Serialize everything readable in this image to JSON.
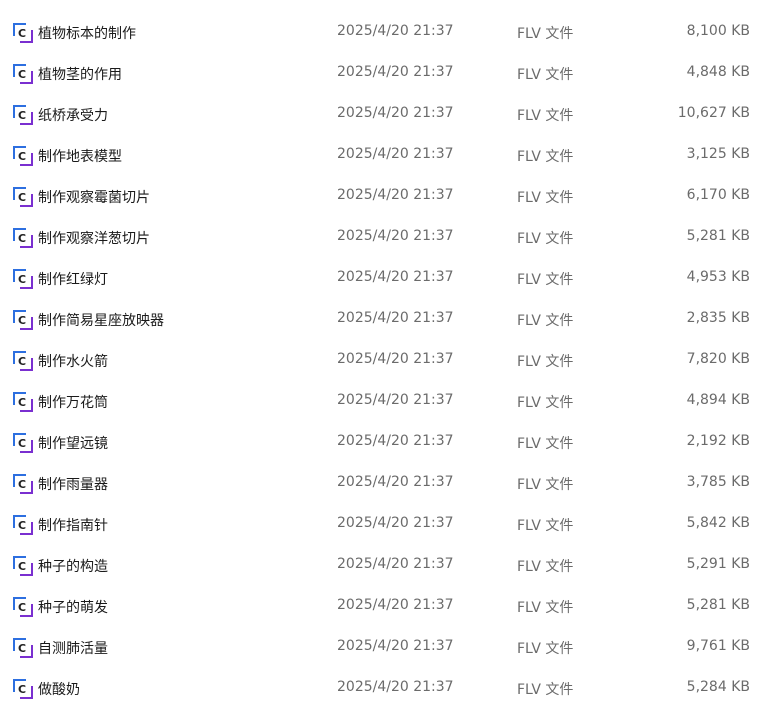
{
  "icon": "video-file-icon",
  "colors": {
    "icon_blue": "#2d6fe0",
    "icon_purple": "#7a2fd0",
    "text": "#1a1a1a",
    "meta": "#6b6b6b"
  },
  "files": [
    {
      "name": "植物标本的制作",
      "date": "2025/4/20 21:37",
      "type": "FLV 文件",
      "size": "8,100 KB"
    },
    {
      "name": "植物茎的作用",
      "date": "2025/4/20 21:37",
      "type": "FLV 文件",
      "size": "4,848 KB"
    },
    {
      "name": "纸桥承受力",
      "date": "2025/4/20 21:37",
      "type": "FLV 文件",
      "size": "10,627 KB"
    },
    {
      "name": "制作地表模型",
      "date": "2025/4/20 21:37",
      "type": "FLV 文件",
      "size": "3,125 KB"
    },
    {
      "name": "制作观察霉菌切片",
      "date": "2025/4/20 21:37",
      "type": "FLV 文件",
      "size": "6,170 KB"
    },
    {
      "name": "制作观察洋葱切片",
      "date": "2025/4/20 21:37",
      "type": "FLV 文件",
      "size": "5,281 KB"
    },
    {
      "name": "制作红绿灯",
      "date": "2025/4/20 21:37",
      "type": "FLV 文件",
      "size": "4,953 KB"
    },
    {
      "name": "制作简易星座放映器",
      "date": "2025/4/20 21:37",
      "type": "FLV 文件",
      "size": "2,835 KB"
    },
    {
      "name": "制作水火箭",
      "date": "2025/4/20 21:37",
      "type": "FLV 文件",
      "size": "7,820 KB"
    },
    {
      "name": "制作万花筒",
      "date": "2025/4/20 21:37",
      "type": "FLV 文件",
      "size": "4,894 KB"
    },
    {
      "name": "制作望远镜",
      "date": "2025/4/20 21:37",
      "type": "FLV 文件",
      "size": "2,192 KB"
    },
    {
      "name": "制作雨量器",
      "date": "2025/4/20 21:37",
      "type": "FLV 文件",
      "size": "3,785 KB"
    },
    {
      "name": "制作指南针",
      "date": "2025/4/20 21:37",
      "type": "FLV 文件",
      "size": "5,842 KB"
    },
    {
      "name": "种子的构造",
      "date": "2025/4/20 21:37",
      "type": "FLV 文件",
      "size": "5,291 KB"
    },
    {
      "name": "种子的萌发",
      "date": "2025/4/20 21:37",
      "type": "FLV 文件",
      "size": "5,281 KB"
    },
    {
      "name": "自测肺活量",
      "date": "2025/4/20 21:37",
      "type": "FLV 文件",
      "size": "9,761 KB"
    },
    {
      "name": "做酸奶",
      "date": "2025/4/20 21:37",
      "type": "FLV 文件",
      "size": "5,284 KB"
    }
  ]
}
